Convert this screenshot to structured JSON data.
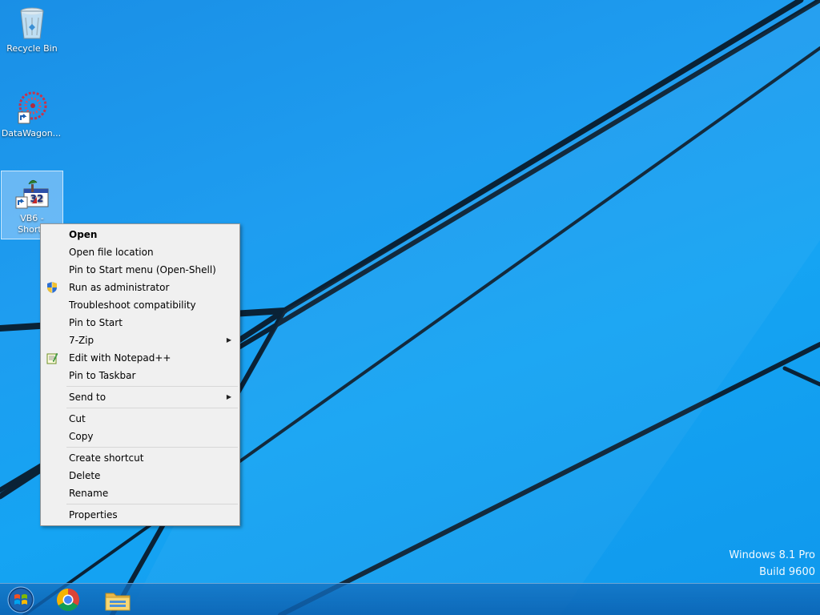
{
  "desktop": {
    "icons": [
      {
        "label": "Recycle Bin"
      },
      {
        "label": "DataWagon..."
      },
      {
        "label_line1": "VB6 -",
        "label_line2": "Shortc"
      }
    ]
  },
  "context_menu": {
    "items": [
      {
        "label": "Open"
      },
      {
        "label": "Open file location"
      },
      {
        "label": "Pin to Start menu (Open-Shell)"
      },
      {
        "label": "Run as administrator"
      },
      {
        "label": "Troubleshoot compatibility"
      },
      {
        "label": "Pin to Start"
      },
      {
        "label": "7-Zip"
      },
      {
        "label": "Edit with Notepad++"
      },
      {
        "label": "Pin to Taskbar"
      },
      {
        "label": "Send to"
      },
      {
        "label": "Cut"
      },
      {
        "label": "Copy"
      },
      {
        "label": "Create shortcut"
      },
      {
        "label": "Delete"
      },
      {
        "label": "Rename"
      },
      {
        "label": "Properties"
      }
    ]
  },
  "watermark": {
    "line1": "Windows 8.1 Pro",
    "line2": "Build 9600"
  },
  "taskbar": {
    "buttons": [
      "start-orb-icon",
      "chrome-icon",
      "file-explorer-icon"
    ]
  },
  "colors": {
    "wallpaper": "#1a9cf0",
    "menu_background": "#f0f0f0"
  }
}
